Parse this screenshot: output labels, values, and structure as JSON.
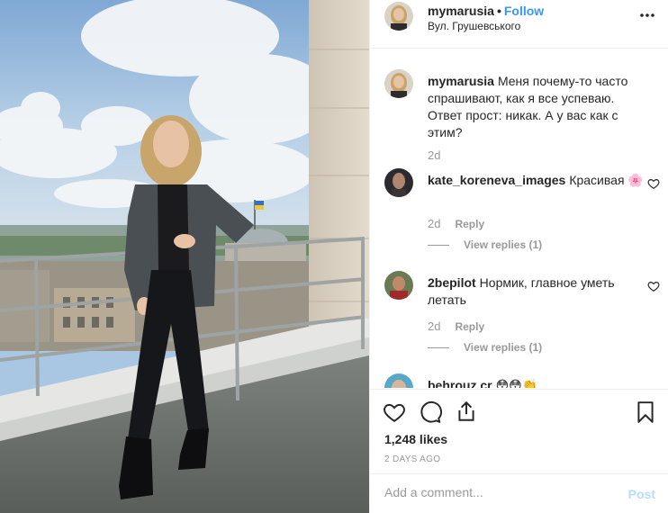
{
  "post": {
    "username": "mymarusia",
    "follow_label": "Follow",
    "dot": "•",
    "location": "Вул. Грушевського"
  },
  "caption": {
    "username": "mymarusia",
    "text": "Меня почему-то часто спрашивают, как я все успеваю. Ответ прост: никак. А у вас как с этим?",
    "time": "2d"
  },
  "comments": [
    {
      "username": "kate_koreneva_images",
      "text": "Красивая 🌸",
      "time": "2d",
      "reply_label": "Reply",
      "replies_label": "View replies (1)"
    },
    {
      "username": "2bepilot",
      "text": "Нормик, главное уметь летать",
      "time": "2d",
      "reply_label": "Reply",
      "replies_label": "View replies (1)"
    },
    {
      "username": "behrouz.cr",
      "text": "😳😳👏"
    }
  ],
  "engagement": {
    "likes": "1,248 likes",
    "posted_ago": "2 DAYS AGO"
  },
  "add_comment": {
    "placeholder": "Add a comment...",
    "post_label": "Post"
  },
  "colors": {
    "accent": "#3897f0",
    "muted": "#999999",
    "post_disabled": "#b2dffc"
  },
  "icons": [
    "more-icon",
    "heart-icon",
    "comment-icon",
    "share-icon",
    "bookmark-icon"
  ]
}
